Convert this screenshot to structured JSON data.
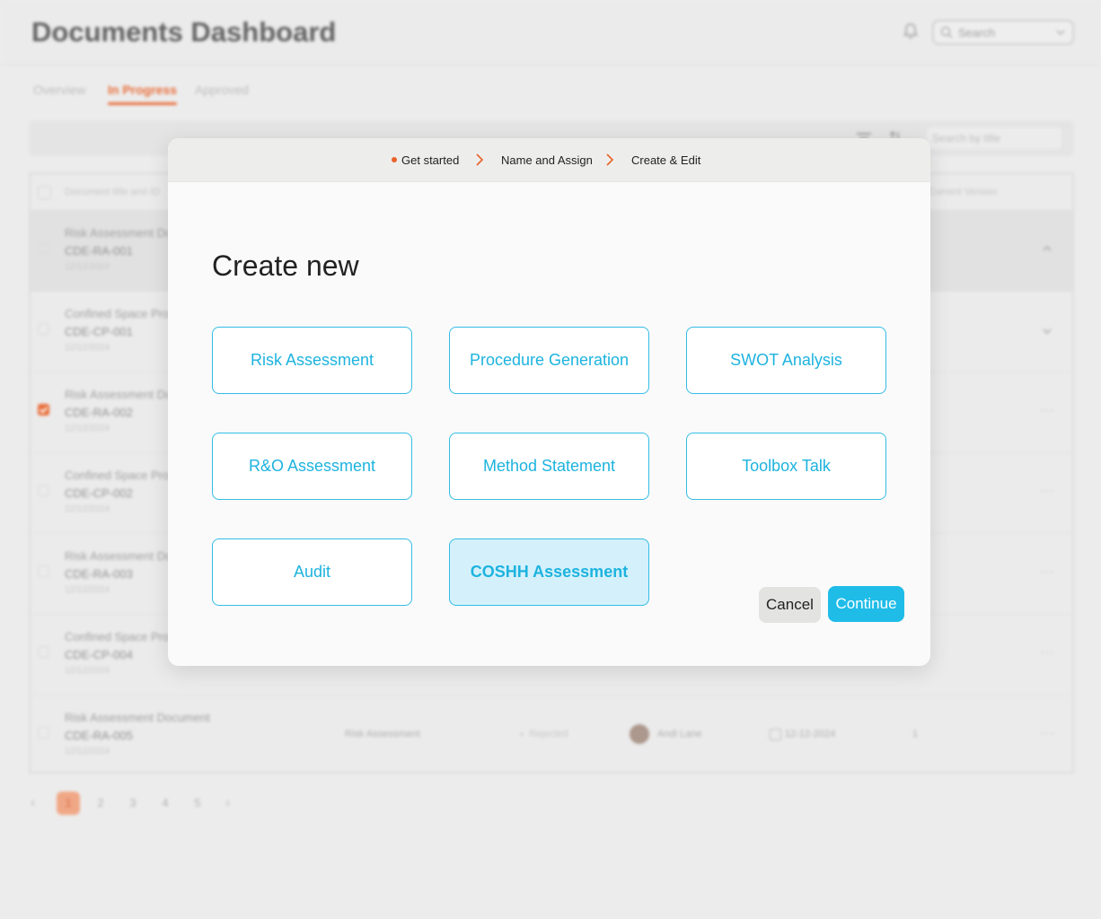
{
  "app": {
    "title": "Documents Dashboard",
    "search_placeholder": "Search",
    "tabs": [
      {
        "label": "Overview"
      },
      {
        "label": "In Progress",
        "active": true
      },
      {
        "label": "Approved"
      }
    ]
  },
  "toolbar": {
    "search_placeholder": "Search by title"
  },
  "table": {
    "headers": {
      "first": "Document title and ID",
      "last": "Current Version"
    },
    "rows": [
      {
        "title": "Risk Assessment Document",
        "id": "CDE-RA-001",
        "date": "12/12/2024",
        "selected": true,
        "checked": false,
        "expanded": true
      },
      {
        "title": "Confined Space Procedure",
        "id": "CDE-CP-001",
        "date": "12/12/2024",
        "selected": false,
        "checked": false,
        "chevron": true
      },
      {
        "title": "Risk Assessment Document",
        "id": "CDE-RA-002",
        "date": "12/12/2024",
        "selected": false,
        "checked": true
      },
      {
        "title": "Confined Space Procedure",
        "id": "CDE-CP-002",
        "date": "12/12/2024",
        "selected": false,
        "checked": false
      },
      {
        "title": "Risk Assessment Document",
        "id": "CDE-RA-003",
        "date": "12/12/2024",
        "selected": false,
        "checked": false
      },
      {
        "title": "Confined Space Procedure",
        "id": "CDE-CP-004",
        "date": "12/12/2024",
        "selected": false,
        "checked": false
      },
      {
        "title": "Risk Assessment Document",
        "id": "CDE-RA-005",
        "date": "12/12/2024",
        "selected": false,
        "checked": false,
        "type": "Risk Assessment",
        "status": "Rejected",
        "owner": "Andi Lane",
        "modified": "12-12-2024",
        "version": "1"
      }
    ],
    "row_actions": "···"
  },
  "pagination": {
    "prev": "‹",
    "next": "›",
    "pages": [
      "1",
      "2",
      "3",
      "4",
      "5"
    ],
    "current": "1"
  },
  "modal": {
    "steps": [
      {
        "label": "Get started",
        "active": true
      },
      {
        "label": "Name and Assign"
      },
      {
        "label": "Create & Edit"
      }
    ],
    "title": "Create new",
    "options": [
      {
        "label": "Risk Assessment"
      },
      {
        "label": "Procedure Generation"
      },
      {
        "label": "SWOT Analysis"
      },
      {
        "label": "R&O Assessment"
      },
      {
        "label": "Method Statement"
      },
      {
        "label": "Toolbox Talk"
      },
      {
        "label": "Audit"
      },
      {
        "label": "COSHH Assessment",
        "selected": true
      }
    ],
    "cancel_label": "Cancel",
    "continue_label": "Continue"
  },
  "colors": {
    "accent_orange": "#e9622a",
    "accent_cyan": "#1fbce8",
    "option_text": "#1db3df",
    "option_selected_bg": "#d4f1fb"
  },
  "icons": [
    "bell-icon",
    "search-icon",
    "chevron-down-icon",
    "filter-icon",
    "sort-icon",
    "chevron-right-icon",
    "calendar-icon",
    "more-icon"
  ]
}
